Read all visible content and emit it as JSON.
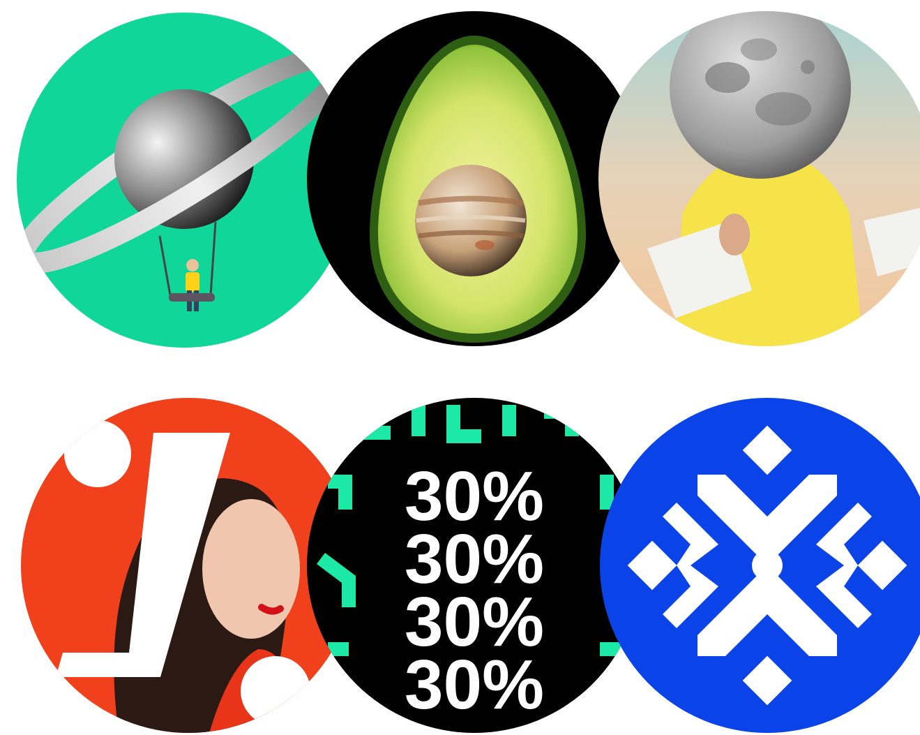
{
  "tiles": [
    {
      "name": "saturn-swing",
      "bg": "#10d69a"
    },
    {
      "name": "avocado-jupiter",
      "bg": "#000000"
    },
    {
      "name": "moon-hoodie",
      "bg": "#e8d8c4"
    },
    {
      "name": "woman-portrait",
      "bg": "#f0411c"
    },
    {
      "name": "discount-30-percent",
      "bg": "#000000",
      "lines": [
        "30%",
        "30%",
        "30%",
        "30%"
      ],
      "accent": "#1de9a6"
    },
    {
      "name": "blue-ornament",
      "bg": "#0a44e8"
    }
  ]
}
